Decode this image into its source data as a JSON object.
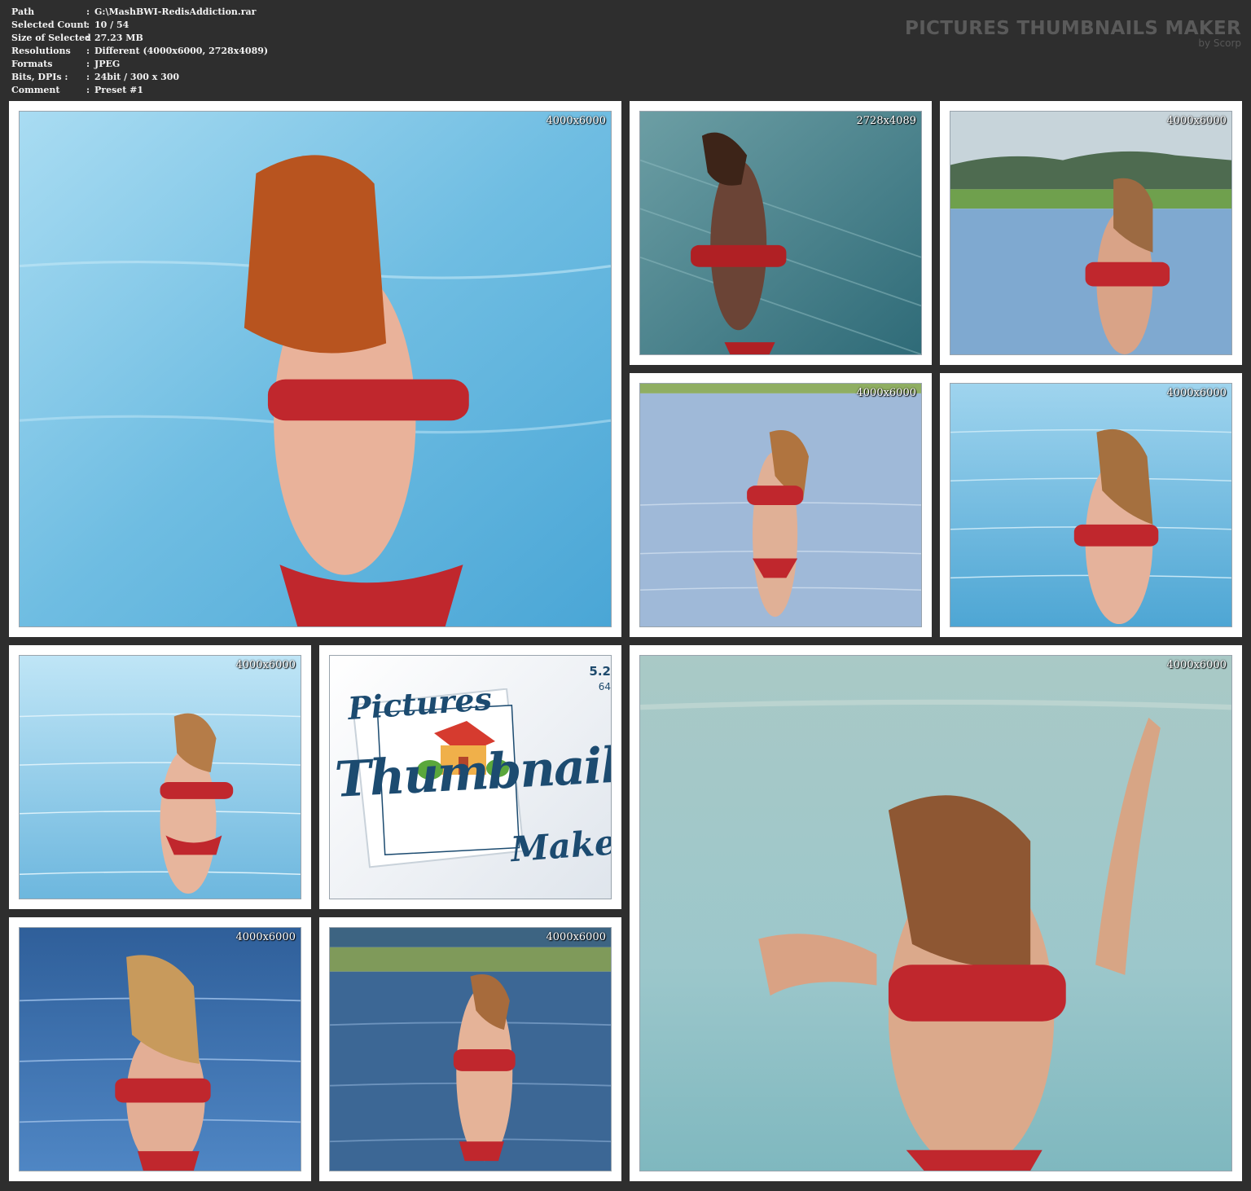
{
  "info": {
    "rows": [
      {
        "key": "Path",
        "value": "G:\\MashBWI-RedisAddiction.rar"
      },
      {
        "key": "Selected Count",
        "value": "10 / 54"
      },
      {
        "key": "Size of Selected",
        "value": "27.23 MB"
      },
      {
        "key": "Resolutions",
        "value": "Different (4000x6000, 2728x4089)"
      },
      {
        "key": "Formats",
        "value": "JPEG"
      },
      {
        "key": "Bits, DPIs :",
        "value": "24bit / 300 x 300"
      },
      {
        "key": "Comment",
        "value": "Preset #1"
      }
    ],
    "separator": ":"
  },
  "brand": {
    "title": "PICTURES THUMBNAILS MAKER",
    "subtitle": "by Scorp"
  },
  "thumbnails": [
    {
      "resolution": "4000x6000"
    },
    {
      "resolution": "2728x4089"
    },
    {
      "resolution": "4000x6000"
    },
    {
      "resolution": "4000x6000"
    },
    {
      "resolution": "4000x6000"
    },
    {
      "resolution": "4000x6000"
    },
    {
      "resolution": "4000x6000"
    },
    {
      "resolution": "4000x6000"
    },
    {
      "resolution": "4000x6000"
    }
  ],
  "logo": {
    "word1": "Pictures",
    "word2": "Thumbnails",
    "word3": "Maker",
    "version": "5.2",
    "bits": "64"
  },
  "colors": {
    "background": "#2e2e2e",
    "tile": "#ffffff",
    "swimsuit": "#c0272d",
    "water": "#7fc3e3"
  }
}
